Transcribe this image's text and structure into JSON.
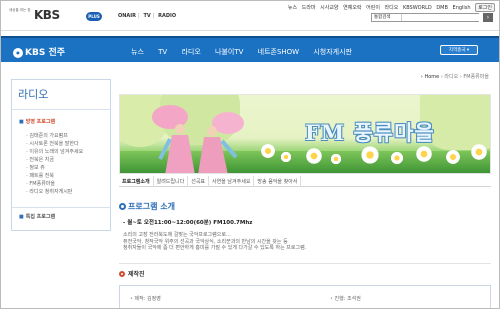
{
  "header": {
    "slogan": "세상을 여는 창",
    "logo": "KBS",
    "logo_badge": "PLUS",
    "services": [
      "ONAIR",
      "TV",
      "RADIO"
    ],
    "top_nav": [
      "뉴스",
      "드라마",
      "시사교양",
      "연예오락",
      "어린이",
      "라디오",
      "KBSWORLD",
      "DMB",
      "English"
    ],
    "login_label": "로그인",
    "search_select": "통합검색",
    "search_button": "›"
  },
  "station": {
    "logo": "KBS 전주",
    "menu": [
      "뉴스",
      "TV",
      "라디오",
      "나불이TV",
      "네트존SHOW",
      "시청자게시판"
    ],
    "region_button": "지역총국 ▾"
  },
  "sidebar": {
    "title": "라디오",
    "section": "방영 프로그램",
    "items": [
      "김태준의 가요펌프",
      "시사토론 전북을 말한다",
      "이유의 노래의 넘겨주세요",
      "전북은 지금",
      "정보 쥬",
      "패트롤 전북",
      "FM풍류마을",
      "라디오 청취자게시판"
    ],
    "special": "특집 프로그램"
  },
  "breadcrumb": {
    "home": "› Home",
    "path": "› 라디오 › FM풍류마을"
  },
  "banner": {
    "title": "FM 풍류마을"
  },
  "tabs": [
    "프로그램소개",
    "알려드립니다",
    "선곡표",
    "사연을 남겨주세요",
    "방송 음악을 찾아서"
  ],
  "program": {
    "title": "프로그램 소개",
    "schedule": "- 월~토 오전11:00~12:00(60분) FM100.7Mhz",
    "desc1": "소리의 고장 전라북도에 걸맞는 국악프로그램으로...",
    "desc2": "퓨전국악, 창작국악 위주의 선곡과 국악상식, 소리꾼과의 만남의 시간을 갖는 등",
    "desc3": "청취자들이 국악에 좀 더 편안하게 흥미를 가질 수 있게 다가갈 수 있도록 하는 프로그램."
  },
  "staff": {
    "title": "제작진",
    "producer": "제작: 김정영",
    "host": "진행: 조석권"
  },
  "colors": {
    "brand_blue": "#1b72c2",
    "accent_red": "#d04b2b"
  }
}
